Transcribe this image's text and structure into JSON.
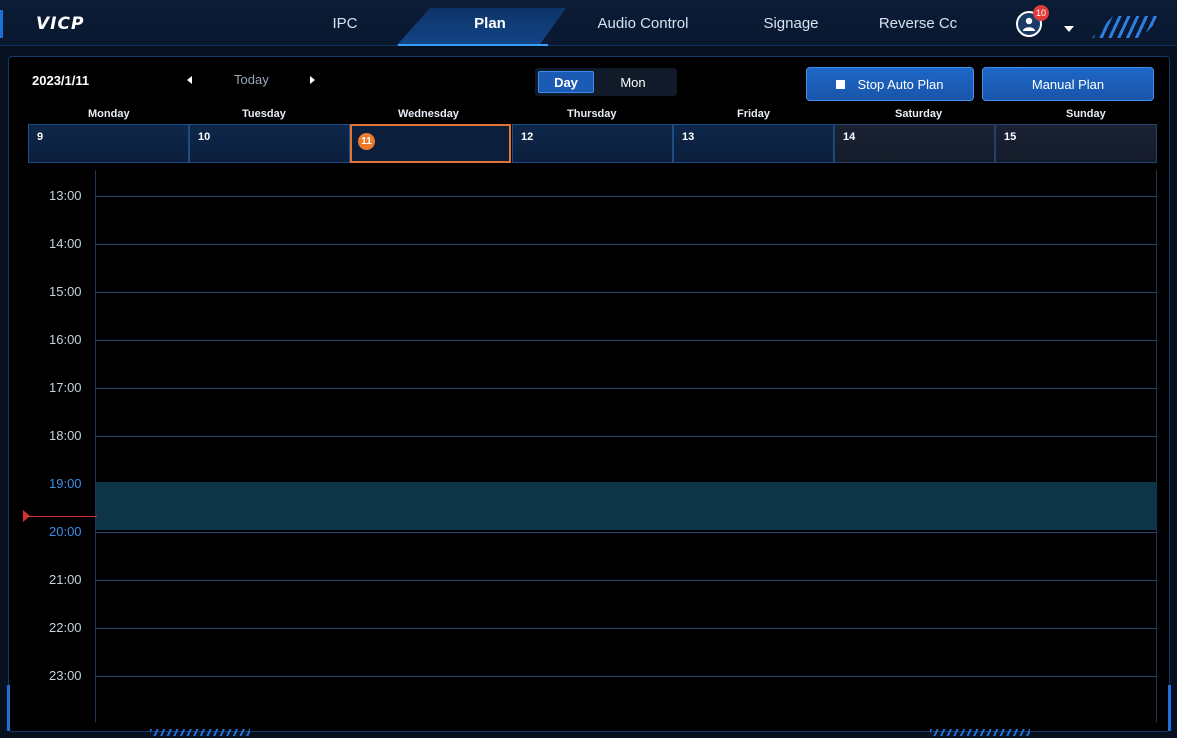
{
  "app": {
    "logo": "VICP"
  },
  "nav": {
    "tabs": [
      {
        "label": "IPC",
        "active": false
      },
      {
        "label": "Plan",
        "active": true
      },
      {
        "label": "Audio Control",
        "active": false
      },
      {
        "label": "Signage",
        "active": false
      },
      {
        "label": "Reverse Cc",
        "active": false
      }
    ],
    "user": {
      "icon": "user-icon",
      "badge_count": "10",
      "menu_icon": "caret-down-icon"
    }
  },
  "toolbar": {
    "date": "2023/1/11",
    "prev_icon": "caret-left-icon",
    "today_label": "Today",
    "next_icon": "caret-right-icon",
    "view_day": "Day",
    "view_mon": "Mon",
    "stop_auto_plan": "Stop Auto Plan",
    "manual_plan": "Manual Plan"
  },
  "week": {
    "days": [
      {
        "name": "Monday",
        "date": "9",
        "weekend": false,
        "today": false
      },
      {
        "name": "Tuesday",
        "date": "10",
        "weekend": false,
        "today": false
      },
      {
        "name": "Wednesday",
        "date": "11",
        "weekend": false,
        "today": true
      },
      {
        "name": "Thursday",
        "date": "12",
        "weekend": false,
        "today": false
      },
      {
        "name": "Friday",
        "date": "13",
        "weekend": false,
        "today": false
      },
      {
        "name": "Saturday",
        "date": "14",
        "weekend": true,
        "today": false
      },
      {
        "name": "Sunday",
        "date": "15",
        "weekend": true,
        "today": false
      }
    ]
  },
  "timeline": {
    "hours": [
      "13:00",
      "14:00",
      "15:00",
      "16:00",
      "17:00",
      "18:00",
      "19:00",
      "20:00",
      "21:00",
      "22:00",
      "23:00"
    ],
    "current_hour": "19:00"
  },
  "colors": {
    "accent": "#1d67c7",
    "today_marker": "#ef7a2e",
    "current_band": "#0e3448",
    "now_indicator": "#d83030"
  }
}
